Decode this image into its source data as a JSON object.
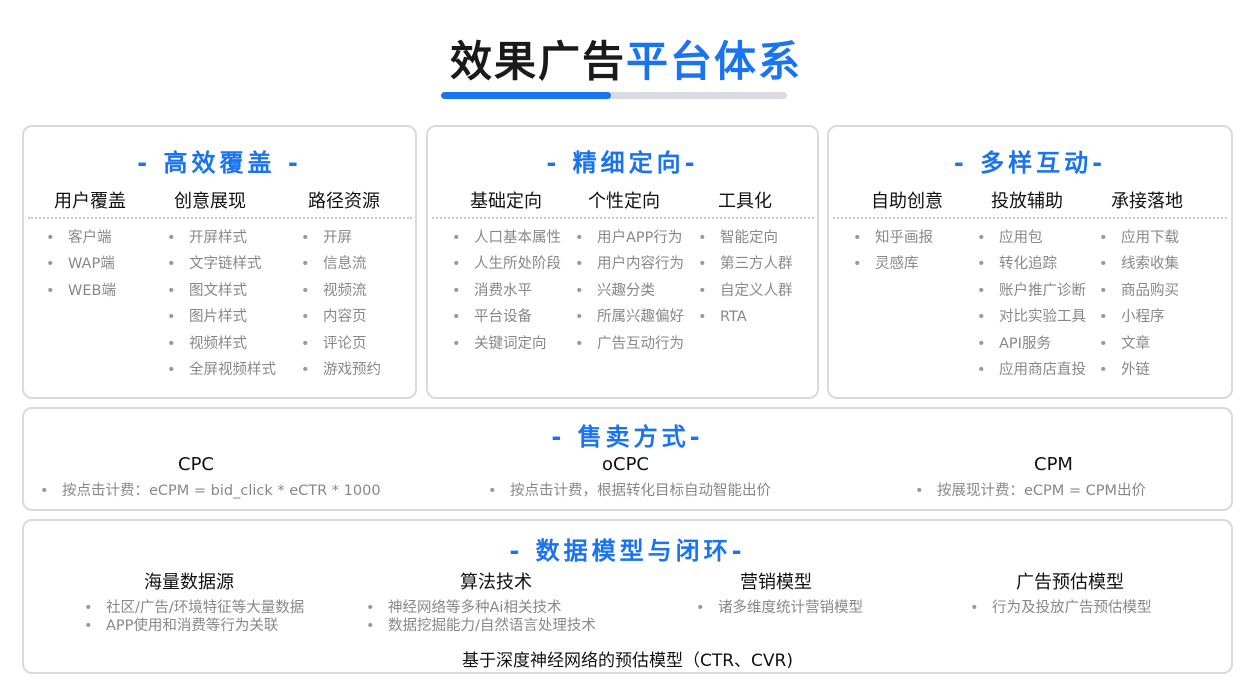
{
  "title": {
    "part1": "效果广告",
    "part2": "平台体系"
  },
  "panels": {
    "coverage": {
      "title": "- 高效覆盖 -",
      "columns": [
        {
          "head": "用户覆盖",
          "items": [
            "客户端",
            "WAP端",
            "WEB端"
          ]
        },
        {
          "head": "创意展现",
          "items": [
            "开屏样式",
            "文字链样式",
            "图文样式",
            "图片样式",
            "视频样式",
            "全屏视频样式"
          ]
        },
        {
          "head": "路径资源",
          "items": [
            "开屏",
            "信息流",
            "视频流",
            "内容页",
            "评论页",
            "游戏预约"
          ]
        }
      ]
    },
    "targeting": {
      "title": "- 精细定向-",
      "columns": [
        {
          "head": "基础定向",
          "items": [
            "人口基本属性",
            "人生所处阶段",
            "消费水平",
            "平台设备",
            "关键词定向"
          ]
        },
        {
          "head": "个性定向",
          "items": [
            "用户APP行为",
            "用户内容行为",
            "兴趣分类",
            "所属兴趣偏好",
            "广告互动行为"
          ]
        },
        {
          "head": "工具化",
          "items": [
            "智能定向",
            "第三方人群",
            "自定义人群",
            "RTA"
          ]
        }
      ]
    },
    "interaction": {
      "title": "- 多样互动-",
      "columns": [
        {
          "head": "自助创意",
          "items": [
            "知乎画报",
            "灵感库"
          ]
        },
        {
          "head": "投放辅助",
          "items": [
            "应用包",
            "转化追踪",
            "账户推广诊断",
            "对比实验工具",
            "API服务",
            "应用商店直投"
          ]
        },
        {
          "head": "承接落地",
          "items": [
            "应用下载",
            "线索收集",
            "商品购买",
            "小程序",
            "文章",
            "外链"
          ]
        }
      ]
    },
    "selling": {
      "title": "- 售卖方式-",
      "columns": [
        {
          "head": "CPC",
          "items": [
            "按点击计费：eCPM = bid_click * eCTR * 1000"
          ]
        },
        {
          "head": "oCPC",
          "items": [
            "按点击计费，根据转化目标自动智能出价"
          ]
        },
        {
          "head": "CPM",
          "items": [
            "按展现计费：eCPM = CPM出价"
          ]
        }
      ]
    },
    "data": {
      "title": "- 数据模型与闭环-",
      "columns": [
        {
          "head": "海量数据源",
          "items": [
            "社区/广告/环境特征等大量数据",
            "APP使用和消费等行为关联"
          ]
        },
        {
          "head": "算法技术",
          "items": [
            "神经网络等多种Ai相关技术",
            "数据挖掘能力/自然语言处理技术"
          ]
        },
        {
          "head": "营销模型",
          "items": [
            "诸多维度统计营销模型"
          ]
        },
        {
          "head": "广告预估模型",
          "items": [
            "行为及投放广告预估模型"
          ]
        }
      ],
      "footer": "基于深度神经网络的预估模型（CTR、CVR)"
    }
  },
  "colors": {
    "accent": "#1a73f0",
    "border": "#d8dadf",
    "text": "#111111",
    "muted": "#888888"
  }
}
